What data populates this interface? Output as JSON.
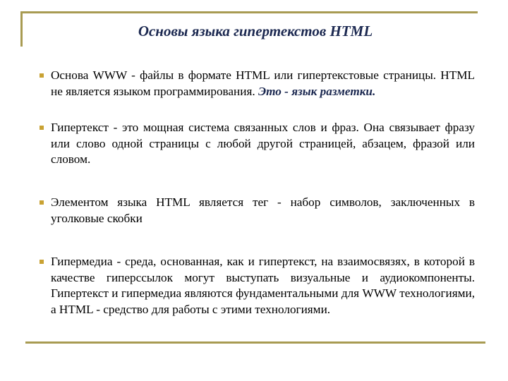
{
  "slide": {
    "title": "Основы языка гипертекстов HTML",
    "bullet_icon": "square-bullet",
    "accent_color": "#A89B52",
    "title_color": "#1B2850",
    "items": [
      {
        "text": "Основа WWW - файлы в формате HTML или гипертекстовые страницы. HTML не является языком программирования. ",
        "emphasis": "Это - язык разметки."
      },
      {
        "text": "Гипертекст - это мощная система связанных слов и фраз. Она связывает фразу или слово одной страницы с любой другой страницей, абзацем, фразой или словом."
      },
      {
        "text": "Элементом языка HTML является тег - набор символов, заключенных в уголковые скобки"
      },
      {
        "text": "Гипермедиа - среда, основанная, как и гипертекст, на взаимосвязях, в которой в качестве гиперссылок могут выступать визуальные и аудиокомпоненты. Гипертекст и гипермедиа являются фундаментальными для WWW технологиями, а HTML - средство для работы с этими технологиями."
      }
    ]
  }
}
